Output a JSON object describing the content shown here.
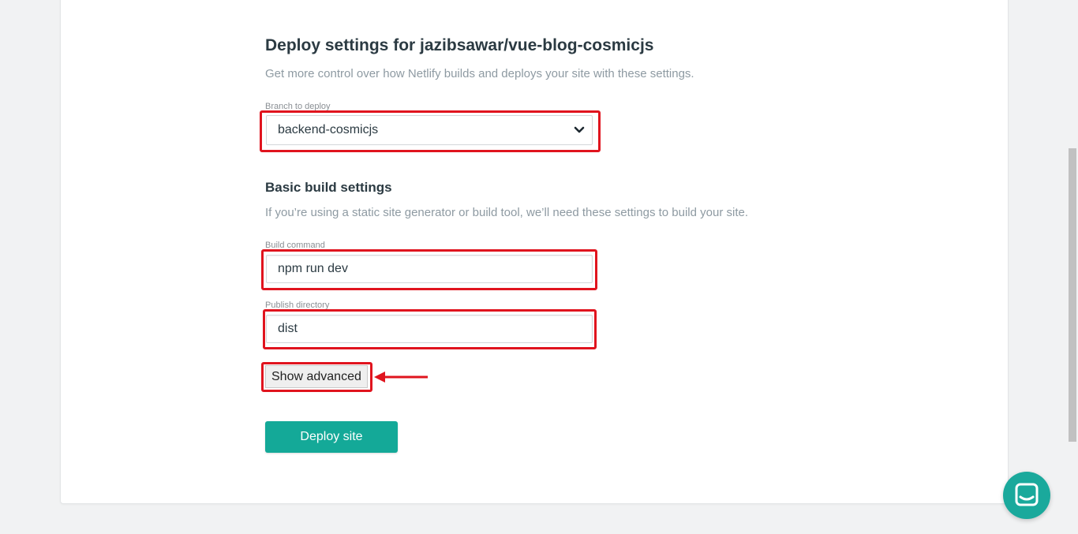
{
  "deploy": {
    "title": "Deploy settings for jazibsawar/vue-blog-cosmicjs",
    "subtitle": "Get more control over how Netlify builds and deploys your site with these settings."
  },
  "branch": {
    "label": "Branch to deploy",
    "value": "backend-cosmicjs"
  },
  "build": {
    "title": "Basic build settings",
    "subtitle": "If you’re using a static site generator or build tool, we’ll need these settings to build your site.",
    "command_label": "Build command",
    "command_value": "npm run dev",
    "publish_label": "Publish directory",
    "publish_value": "dist"
  },
  "actions": {
    "show_advanced": "Show advanced",
    "deploy": "Deploy site"
  },
  "colors": {
    "accent": "#14a998",
    "highlight": "#e0141e"
  },
  "icons": {
    "select_chevron": "chevron-down-icon",
    "chat": "chat-icon",
    "annotation_arrow": "arrow-left-icon"
  }
}
